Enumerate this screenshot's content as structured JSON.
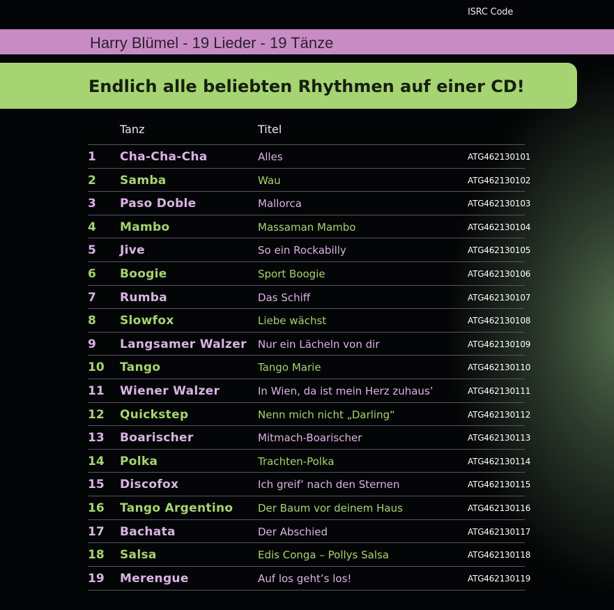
{
  "header_band": "Harry Blümel - 19 Lieder - 19 Tänze",
  "banner": "Endlich alle beliebten Rhythmen auf einer CD!",
  "colors": {
    "pink": "#c88cc4",
    "green": "#a6d472",
    "background": "#040506"
  },
  "table": {
    "columns": [
      "Tanz",
      "Titel",
      "ISRC Code"
    ],
    "rows": [
      {
        "n": "1",
        "tanz": "Cha-Cha-Cha",
        "titel": "Alles",
        "isrc": "ATG462130101"
      },
      {
        "n": "2",
        "tanz": "Samba",
        "titel": "Wau",
        "isrc": "ATG462130102"
      },
      {
        "n": "3",
        "tanz": "Paso Doble",
        "titel": "Mallorca",
        "isrc": "ATG462130103"
      },
      {
        "n": "4",
        "tanz": "Mambo",
        "titel": "Massaman Mambo",
        "isrc": "ATG462130104"
      },
      {
        "n": "5",
        "tanz": "Jive",
        "titel": "So ein Rockabilly",
        "isrc": "ATG462130105"
      },
      {
        "n": "6",
        "tanz": "Boogie",
        "titel": "Sport Boogie",
        "isrc": "ATG462130106"
      },
      {
        "n": "7",
        "tanz": "Rumba",
        "titel": "Das Schiff",
        "isrc": "ATG462130107"
      },
      {
        "n": "8",
        "tanz": "Slowfox",
        "titel": "Liebe wächst",
        "isrc": "ATG462130108"
      },
      {
        "n": "9",
        "tanz": "Langsamer Walzer",
        "titel": "Nur ein Lächeln von dir",
        "isrc": "ATG462130109"
      },
      {
        "n": "10",
        "tanz": "Tango",
        "titel": "Tango Marie",
        "isrc": "ATG462130110"
      },
      {
        "n": "11",
        "tanz": "Wiener Walzer",
        "titel": "In Wien, da ist mein Herz zuhaus’",
        "isrc": "ATG462130111"
      },
      {
        "n": "12",
        "tanz": "Quickstep",
        "titel": "Nenn mich nicht „Darling“",
        "isrc": "ATG462130112"
      },
      {
        "n": "13",
        "tanz": "Boarischer",
        "titel": "Mitmach-Boarischer",
        "isrc": "ATG462130113"
      },
      {
        "n": "14",
        "tanz": "Polka",
        "titel": "Trachten-Polka",
        "isrc": "ATG462130114"
      },
      {
        "n": "15",
        "tanz": "Discofox",
        "titel": "Ich greif’ nach den Sternen",
        "isrc": "ATG462130115"
      },
      {
        "n": "16",
        "tanz": "Tango Argentino",
        "titel": "Der Baum vor deinem Haus",
        "isrc": "ATG462130116"
      },
      {
        "n": "17",
        "tanz": "Bachata",
        "titel": "Der Abschied",
        "isrc": "ATG462130117"
      },
      {
        "n": "18",
        "tanz": "Salsa",
        "titel": "Edis Conga – Pollys Salsa",
        "isrc": "ATG462130118"
      },
      {
        "n": "19",
        "tanz": "Merengue",
        "titel": "Auf los geht’s los!",
        "isrc": "ATG462130119"
      }
    ]
  }
}
